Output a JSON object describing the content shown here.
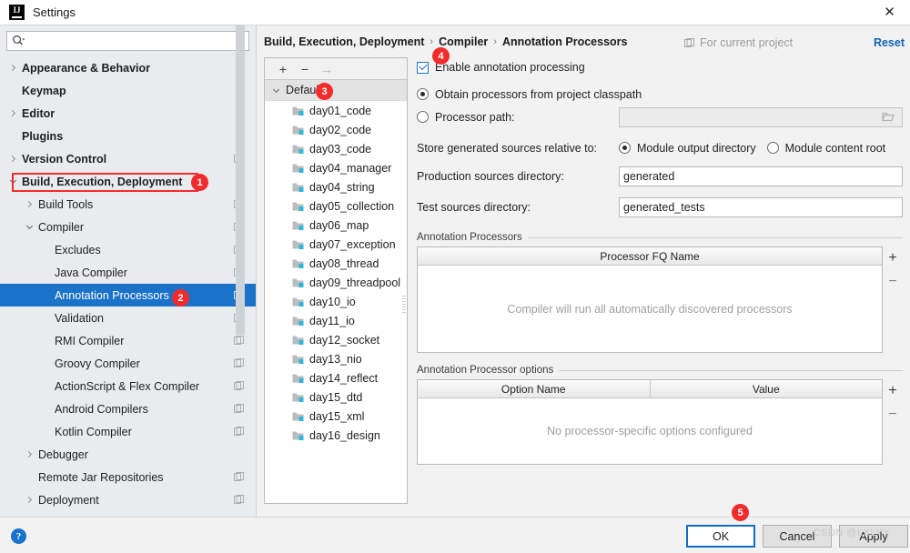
{
  "window": {
    "title": "Settings",
    "logo_icon": "intellij-idea-logo-icon",
    "close_icon": "close-icon"
  },
  "search": {
    "icon": "search-icon",
    "value": "",
    "placeholder": ""
  },
  "sidebar": {
    "scrollbar_name": "sidebar-scrollbar",
    "items": [
      {
        "label": "Appearance & Behavior",
        "indent": 1,
        "chevron": "right",
        "bold": true,
        "project_badge": false,
        "selected": false
      },
      {
        "label": "Keymap",
        "indent": 1,
        "chevron": "none",
        "bold": true,
        "project_badge": false,
        "selected": false
      },
      {
        "label": "Editor",
        "indent": 1,
        "chevron": "right",
        "bold": true,
        "project_badge": false,
        "selected": false
      },
      {
        "label": "Plugins",
        "indent": 1,
        "chevron": "none",
        "bold": true,
        "project_badge": false,
        "selected": false
      },
      {
        "label": "Version Control",
        "indent": 1,
        "chevron": "right",
        "bold": true,
        "project_badge": true,
        "selected": false
      },
      {
        "label": "Build, Execution, Deployment",
        "indent": 1,
        "chevron": "down",
        "bold": true,
        "project_badge": false,
        "selected": false
      },
      {
        "label": "Build Tools",
        "indent": 2,
        "chevron": "right",
        "bold": false,
        "project_badge": true,
        "selected": false
      },
      {
        "label": "Compiler",
        "indent": 2,
        "chevron": "down",
        "bold": false,
        "project_badge": true,
        "selected": false
      },
      {
        "label": "Excludes",
        "indent": 3,
        "chevron": "none",
        "bold": false,
        "project_badge": true,
        "selected": false
      },
      {
        "label": "Java Compiler",
        "indent": 3,
        "chevron": "none",
        "bold": false,
        "project_badge": true,
        "selected": false
      },
      {
        "label": "Annotation Processors",
        "indent": 3,
        "chevron": "none",
        "bold": false,
        "project_badge": true,
        "selected": true
      },
      {
        "label": "Validation",
        "indent": 3,
        "chevron": "none",
        "bold": false,
        "project_badge": true,
        "selected": false
      },
      {
        "label": "RMI Compiler",
        "indent": 3,
        "chevron": "none",
        "bold": false,
        "project_badge": true,
        "selected": false
      },
      {
        "label": "Groovy Compiler",
        "indent": 3,
        "chevron": "none",
        "bold": false,
        "project_badge": true,
        "selected": false
      },
      {
        "label": "ActionScript & Flex Compiler",
        "indent": 3,
        "chevron": "none",
        "bold": false,
        "project_badge": true,
        "selected": false
      },
      {
        "label": "Android Compilers",
        "indent": 3,
        "chevron": "none",
        "bold": false,
        "project_badge": true,
        "selected": false
      },
      {
        "label": "Kotlin Compiler",
        "indent": 3,
        "chevron": "none",
        "bold": false,
        "project_badge": true,
        "selected": false
      },
      {
        "label": "Debugger",
        "indent": 2,
        "chevron": "right",
        "bold": false,
        "project_badge": false,
        "selected": false
      },
      {
        "label": "Remote Jar Repositories",
        "indent": 2,
        "chevron": "none",
        "bold": false,
        "project_badge": true,
        "selected": false
      },
      {
        "label": "Deployment",
        "indent": 2,
        "chevron": "right",
        "bold": false,
        "project_badge": true,
        "selected": false
      }
    ]
  },
  "header": {
    "breadcrumb": [
      "Build, Execution, Deployment",
      "Compiler",
      "Annotation Processors"
    ],
    "separator": "›",
    "for_current_project": "For current project",
    "for_current_project_icon": "project-scope-icon",
    "reset": "Reset"
  },
  "modules": {
    "toolbar": {
      "add": "+",
      "remove": "−",
      "move": "→",
      "add_name": "add-profile-button",
      "remove_name": "remove-profile-button",
      "move_name": "move-to-profile-button"
    },
    "group_label": "Default",
    "group_chevron": "down",
    "items": [
      "day01_code",
      "day02_code",
      "day03_code",
      "day04_manager",
      "day04_string",
      "day05_collection",
      "day06_map",
      "day07_exception",
      "day08_thread",
      "day09_threadpool",
      "day10_io",
      "day11_io",
      "day12_socket",
      "day13_nio",
      "day14_reflect",
      "day15_dtd",
      "day15_xml",
      "day16_design"
    ],
    "item_icon": "module-folder-icon"
  },
  "form": {
    "enable_annotation_processing": {
      "label": "Enable annotation processing",
      "checked": true
    },
    "processor_source": {
      "options": [
        {
          "label": "Obtain processors from project classpath",
          "selected": true
        },
        {
          "label": "Processor path:",
          "selected": false
        }
      ],
      "processor_path_value": "",
      "processor_path_enabled": false,
      "browse_icon": "folder-browse-icon"
    },
    "store_generated_sources": {
      "label": "Store generated sources relative to:",
      "options": [
        {
          "label": "Module output directory",
          "selected": true
        },
        {
          "label": "Module content root",
          "selected": false
        }
      ]
    },
    "production_sources": {
      "label": "Production sources directory:",
      "value": "generated"
    },
    "test_sources": {
      "label": "Test sources directory:",
      "value": "generated_tests"
    },
    "processors_table": {
      "group_title": "Annotation Processors",
      "columns": [
        "Processor FQ Name"
      ],
      "rows": [],
      "empty_text": "Compiler will run all automatically discovered processors",
      "add": "+",
      "remove": "−"
    },
    "options_table": {
      "group_title": "Annotation Processor options",
      "columns": [
        "Option Name",
        "Value"
      ],
      "rows": [],
      "empty_text": "No processor-specific options configured",
      "add": "+",
      "remove": "−"
    }
  },
  "footer": {
    "help_icon": "help-icon",
    "help_label": "?",
    "ok": "OK",
    "cancel": "Cancel",
    "apply": "Apply",
    "watermark": "CSDN @LXLYY"
  },
  "annotations": {
    "accent_color": "#f22c2c",
    "badges": [
      {
        "n": "1",
        "target": "sidebar-item-build-execution-deployment"
      },
      {
        "n": "2",
        "target": "sidebar-item-annotation-processors"
      },
      {
        "n": "3",
        "target": "module-group-default"
      },
      {
        "n": "4",
        "target": "enable-annotation-processing-checkbox"
      },
      {
        "n": "5",
        "target": "ok-button"
      }
    ]
  }
}
